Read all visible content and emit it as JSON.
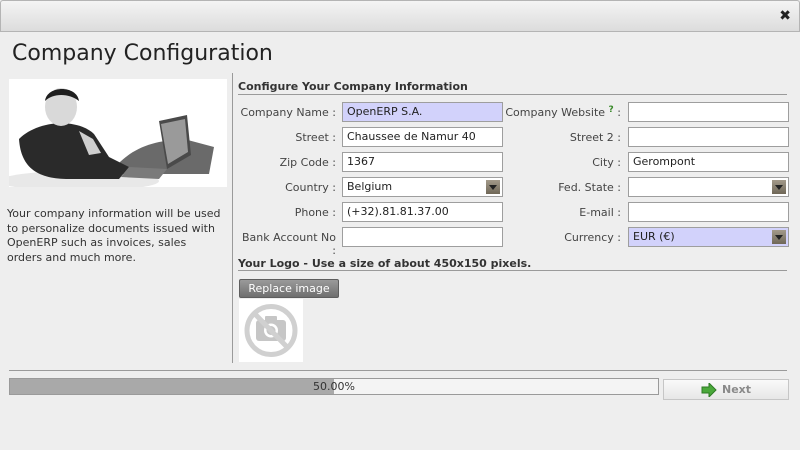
{
  "window": {
    "close_glyph": "✖"
  },
  "page": {
    "title": "Company Configuration",
    "intro": "Your company information will be used to personalize documents issued with OpenERP such as invoices, sales orders and much more."
  },
  "form": {
    "section_title": "Configure Your Company Information",
    "company_name": {
      "label": "Company Name :",
      "value": "OpenERP S.A."
    },
    "company_website": {
      "label": "Company Website",
      "help": "?",
      "colon": ":",
      "value": ""
    },
    "street": {
      "label": "Street :",
      "value": "Chaussee de Namur 40"
    },
    "street2": {
      "label": "Street 2 :",
      "value": ""
    },
    "zip": {
      "label": "Zip Code :",
      "value": "1367"
    },
    "city": {
      "label": "City :",
      "value": "Gerompont"
    },
    "country": {
      "label": "Country :",
      "value": "Belgium"
    },
    "state": {
      "label": "Fed. State :",
      "value": ""
    },
    "phone": {
      "label": "Phone :",
      "value": "(+32).81.81.37.00"
    },
    "email": {
      "label": "E-mail :",
      "value": ""
    },
    "bank": {
      "label": "Bank Account No :",
      "value": ""
    },
    "currency": {
      "label": "Currency :",
      "value": "EUR (€)"
    }
  },
  "logo": {
    "section_title": "Your Logo - Use a size of about 450x150 pixels.",
    "replace_label": "Replace image",
    "placeholder_icon": "no-camera-icon"
  },
  "footer": {
    "progress": 0.5,
    "progress_text": "50.00%",
    "next_label": "Next",
    "next_icon": "green-arrow-icon"
  }
}
